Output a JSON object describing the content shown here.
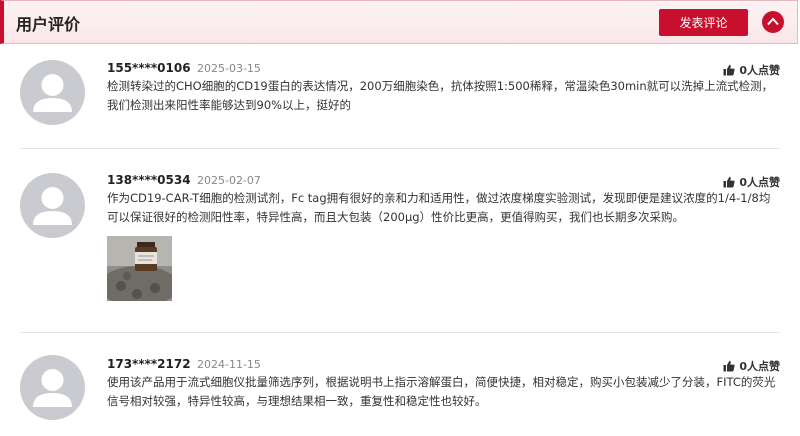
{
  "header": {
    "title": "用户评价",
    "post_button": "发表评论"
  },
  "reviews": [
    {
      "user": "155****0106",
      "date": "2025-03-15",
      "likes": "0人点赞",
      "text": "检测转染过的CHO细胞的CD19蛋白的表达情况，200万细胞染色，抗体按照1:500稀释，常温染色30min就可以洗掉上流式检测，我们检测出来阳性率能够达到90%以上，挺好的"
    },
    {
      "user": "138****0534",
      "date": "2025-02-07",
      "likes": "0人点赞",
      "text": "作为CD19-CAR-T细胞的检测试剂，Fc tag拥有很好的亲和力和适用性，做过浓度梯度实验测试，发现即便是建议浓度的1/4-1/8均可以保证很好的检测阳性率，特异性高，而且大包装（200μg）性价比更高，更值得购买，我们也长期多次采购。"
    },
    {
      "user": "173****2172",
      "date": "2024-11-15",
      "likes": "0人点赞",
      "text": "使用该产品用于流式细胞仪批量筛选序列，根据说明书上指示溶解蛋白，简便快捷，相对稳定，购买小包装减少了分装，FITC的荧光信号相对较强，特异性较高，与理想结果相一致，重复性和稳定性也较好。"
    }
  ]
}
